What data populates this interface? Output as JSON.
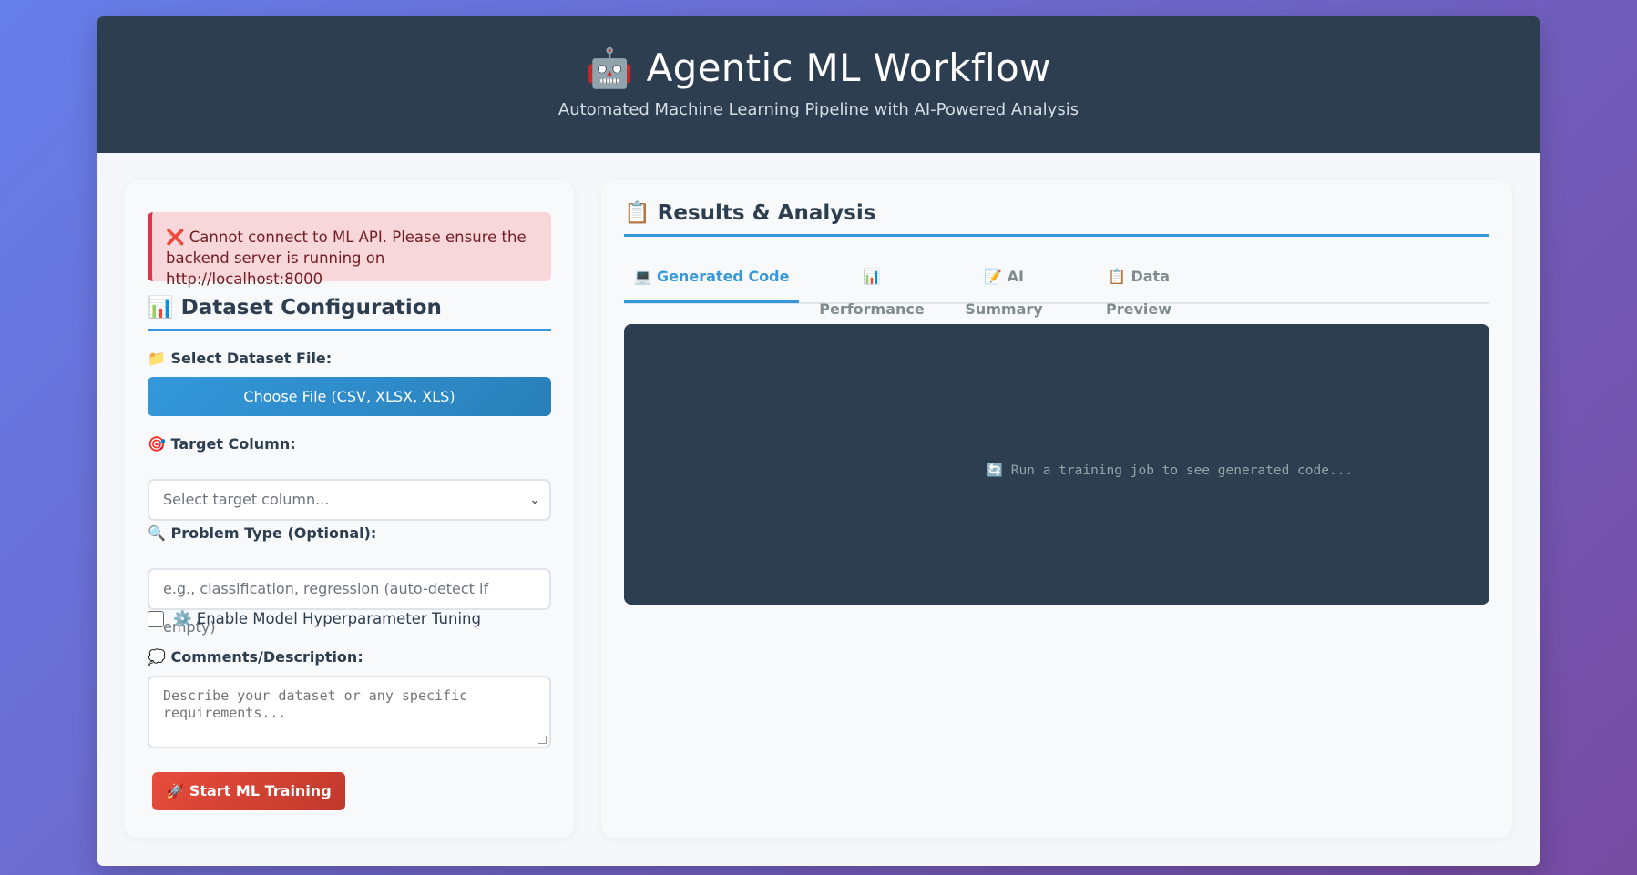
{
  "header": {
    "title": "🤖 Agentic ML Workflow",
    "subtitle": "Automated Machine Learning Pipeline with AI-Powered Analysis"
  },
  "alert": {
    "message_line1": "❌ Cannot connect to ML API. Please ensure the",
    "message_line2": "backend server is running on http://localhost:8000"
  },
  "config": {
    "title": "📊 Dataset Configuration",
    "file_label": "📁 Select Dataset File:",
    "file_button": "Choose File (CSV, XLSX, XLS)",
    "target_label": "🎯 Target Column:",
    "target_placeholder": "Select target column...",
    "problem_label": "🔍 Problem Type (Optional):",
    "problem_placeholder": "e.g., classification, regression (auto-detect if empty)",
    "tuning_label": "⚙️ Enable Model Hyperparameter Tuning",
    "tuning_checked": false,
    "comments_label": "💭 Comments/Description:",
    "comments_placeholder_line1": "Describe your dataset or any specific",
    "comments_placeholder_line2": "requirements...",
    "train_button": "🚀 Start ML Training"
  },
  "results": {
    "title": "📋 Results & Analysis",
    "tabs": [
      {
        "label": "💻 Generated Code",
        "active": true
      },
      {
        "label": "📊 Performance",
        "active": false
      },
      {
        "label": "📝 AI Summary",
        "active": false
      },
      {
        "label": "📋 Data Preview",
        "active": false
      }
    ],
    "code_message": "🔄 Run a training job to see generated code..."
  },
  "colors": {
    "accent": "#3498db",
    "header_bg": "#2c3e50",
    "danger": "#e74c3c",
    "alert_bg": "#f8d7da"
  }
}
